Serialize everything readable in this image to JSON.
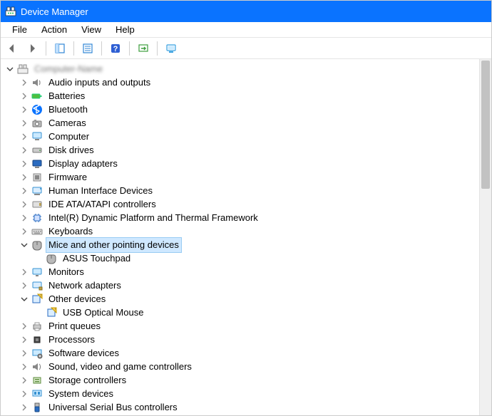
{
  "title": "Device Manager",
  "menus": {
    "file": "File",
    "action": "Action",
    "view": "View",
    "help": "Help"
  },
  "toolbar": {
    "back": "back",
    "forward": "forward",
    "up": "up",
    "properties": "properties",
    "help": "help",
    "scan": "scan",
    "monitor": "monitor"
  },
  "tree": {
    "root": "Computer-Name",
    "items": [
      {
        "label": "Audio inputs and outputs",
        "icon": "speaker"
      },
      {
        "label": "Batteries",
        "icon": "battery"
      },
      {
        "label": "Bluetooth",
        "icon": "bluetooth"
      },
      {
        "label": "Cameras",
        "icon": "camera"
      },
      {
        "label": "Computer",
        "icon": "computer"
      },
      {
        "label": "Disk drives",
        "icon": "disk"
      },
      {
        "label": "Display adapters",
        "icon": "display"
      },
      {
        "label": "Firmware",
        "icon": "firmware"
      },
      {
        "label": "Human Interface Devices",
        "icon": "hid"
      },
      {
        "label": "IDE ATA/ATAPI controllers",
        "icon": "ide"
      },
      {
        "label": "Intel(R) Dynamic Platform and Thermal Framework",
        "icon": "chip"
      },
      {
        "label": "Keyboards",
        "icon": "keyboard"
      },
      {
        "label": "Mice and other pointing devices",
        "icon": "mouse",
        "expanded": true,
        "selected": true,
        "children": [
          {
            "label": "ASUS Touchpad",
            "icon": "mouse"
          }
        ]
      },
      {
        "label": "Monitors",
        "icon": "monitor"
      },
      {
        "label": "Network adapters",
        "icon": "network"
      },
      {
        "label": "Other devices",
        "icon": "other",
        "expanded": true,
        "children": [
          {
            "label": "USB Optical Mouse",
            "icon": "other-child"
          }
        ]
      },
      {
        "label": "Print queues",
        "icon": "printer"
      },
      {
        "label": "Processors",
        "icon": "cpu"
      },
      {
        "label": "Software devices",
        "icon": "software"
      },
      {
        "label": "Sound, video and game controllers",
        "icon": "sound"
      },
      {
        "label": "Storage controllers",
        "icon": "storage"
      },
      {
        "label": "System devices",
        "icon": "system"
      },
      {
        "label": "Universal Serial Bus controllers",
        "icon": "usb"
      }
    ]
  }
}
